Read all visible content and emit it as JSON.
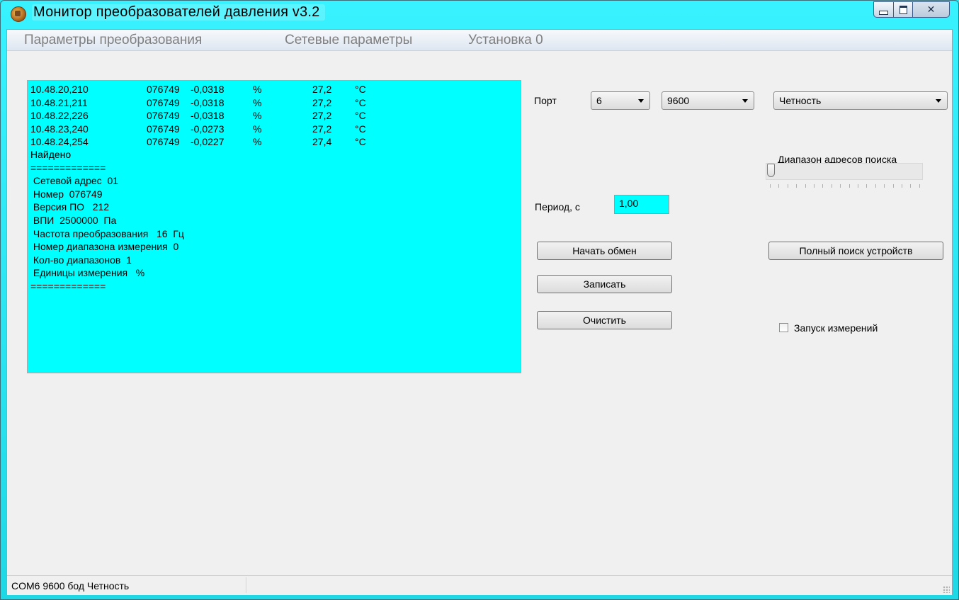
{
  "window": {
    "title": "Монитор преобразователей давления v3.2"
  },
  "menu": [
    "Параметры преобразования",
    "Сетевые параметры",
    "Установка 0"
  ],
  "log": {
    "rows": [
      {
        "addr": "10.48.20,210",
        "num": "076749",
        "value": "-0,0318",
        "unit": "%",
        "temp": "27,2",
        "tunit": "°C"
      },
      {
        "addr": "10.48.21,211",
        "num": "076749",
        "value": "-0,0318",
        "unit": "%",
        "temp": "27,2",
        "tunit": "°C"
      },
      {
        "addr": "10.48.22,226",
        "num": "076749",
        "value": "-0,0318",
        "unit": "%",
        "temp": "27,2",
        "tunit": "°C"
      },
      {
        "addr": "10.48.23,240",
        "num": "076749",
        "value": "-0,0273",
        "unit": "%",
        "temp": "27,2",
        "tunit": "°C"
      },
      {
        "addr": "10.48.24,254",
        "num": "076749",
        "value": "-0,0227",
        "unit": "%",
        "temp": "27,4",
        "tunit": "°C"
      }
    ],
    "lines": [
      "Найдено",
      "=============",
      " Сетевой адрес  01",
      " Номер  076749",
      " Версия ПО   212",
      " ВПИ  2500000  Па",
      " Частота преобразования   16  Гц",
      " Номер диапазона измерения  0",
      " Кол-во диапазонов  1",
      " Единицы измерения   %",
      "============="
    ]
  },
  "port": {
    "label": "Порт",
    "port_value": "6",
    "baud_value": "9600",
    "parity_value": "Четность"
  },
  "range_label": "Диапазон адресов поиска",
  "range_slider": {
    "value": 0
  },
  "period": {
    "label": "Период, с",
    "value": "1,00"
  },
  "buttons": {
    "start": "Начать обмен",
    "write": "Записать",
    "clear": "Очистить",
    "full_search": "Полный поиск устройств"
  },
  "measure_checkbox": {
    "label": "Запуск измерений",
    "checked": false
  },
  "status": {
    "text": "COM6 9600 бод  Четность"
  }
}
